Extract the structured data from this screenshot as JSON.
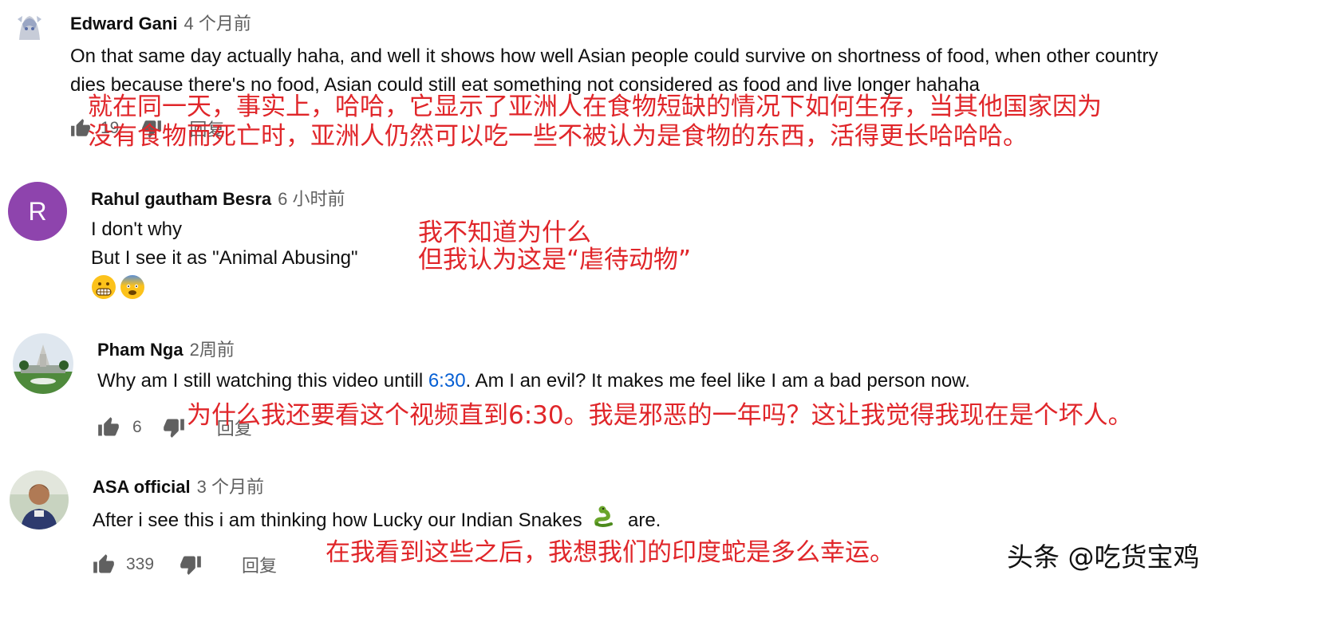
{
  "comments": [
    {
      "author": "Edward Gani",
      "time": "4 个月前",
      "lines": [
        "On that same day actually haha, and well it shows how well Asian people could survive on shortness of food, when other country",
        "dies because there's no food, Asian could still eat something not considered as food and live longer hahaha"
      ],
      "translation": [
        "就在同一天，事实上，哈哈，它显示了亚洲人在食物短缺的情况下如何生存，当其他国家因为",
        "没有食物而死亡时，亚洲人仍然可以吃一些不被认为是食物的东西，活得更长哈哈哈。"
      ],
      "likes": "19",
      "reply_label": "回复"
    },
    {
      "author": "Rahul gautham Besra",
      "time": "6 小时前",
      "avatar_letter": "R",
      "avatar_color": "#8e44ad",
      "lines": [
        "I don't why",
        "But I see it as \"Animal Abusing\""
      ],
      "emojis": [
        "grimacing-face",
        "fearful-face"
      ],
      "translation": [
        "我不知道为什么",
        "但我认为这是“虐待动物”"
      ]
    },
    {
      "author": "Pham Nga",
      "time": "2周前",
      "text_before": "Why am I still watching this video untill ",
      "timestamp_link": "6:30",
      "text_after": ". Am I an evil? It makes me feel like I am a bad person now.",
      "translation": "为什么我还要看这个视频直到6:30。我是邪恶的一年吗？这让我觉得我现在是个坏人。",
      "likes": "6",
      "reply_label": "回复"
    },
    {
      "author": "ASA official",
      "time": "3 个月前",
      "text_before": "After i see this i am thinking how Lucky our Indian Snakes ",
      "emoji": "snake",
      "text_after": " are.",
      "translation": "在我看到这些之后，我想我们的印度蛇是多么幸运。",
      "likes": "339",
      "reply_label": "回复"
    }
  ],
  "watermark": "头条 @吃货宝鸡",
  "colors": {
    "translation_red": "#e0262a",
    "link_blue": "#065fd4",
    "meta_gray": "#606060"
  }
}
